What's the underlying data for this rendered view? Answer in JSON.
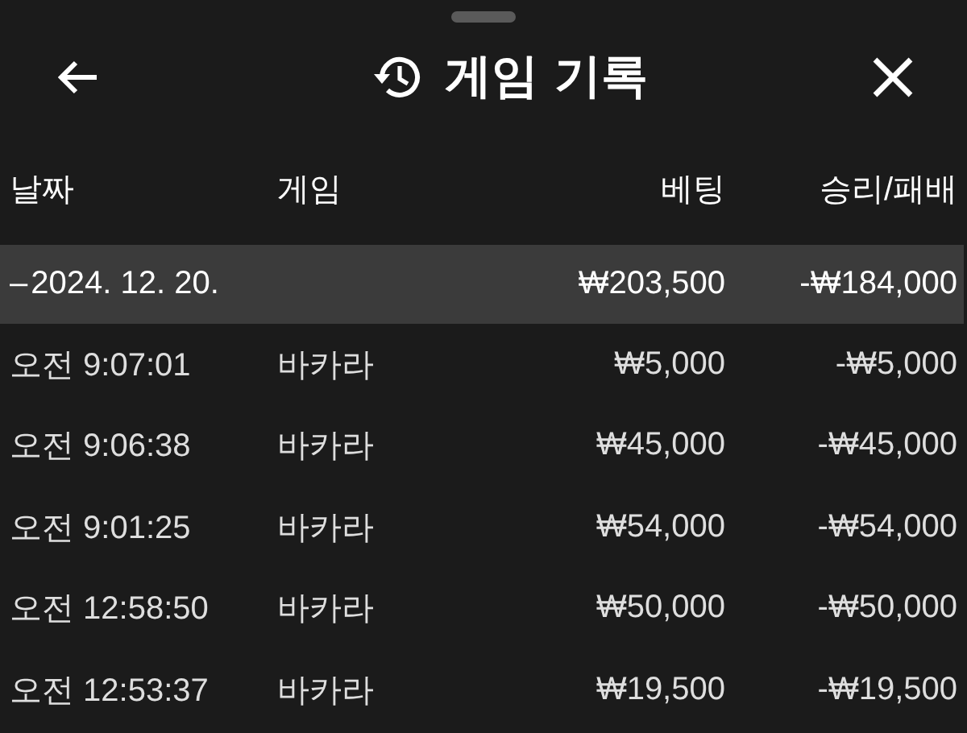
{
  "header": {
    "title": "게임 기록"
  },
  "table": {
    "columns": [
      "날짜",
      "게임",
      "베팅",
      "승리/패배"
    ],
    "groups": [
      {
        "toggle": "–",
        "date": "2024. 12. 20.",
        "bet": "₩203,500",
        "result": "-₩184,000",
        "expanded": true,
        "rows": [
          {
            "time": "오전 9:07:01",
            "game": "바카라",
            "bet": "₩5,000",
            "result": "-₩5,000"
          },
          {
            "time": "오전 9:06:38",
            "game": "바카라",
            "bet": "₩45,000",
            "result": "-₩45,000"
          },
          {
            "time": "오전 9:01:25",
            "game": "바카라",
            "bet": "₩54,000",
            "result": "-₩54,000"
          },
          {
            "time": "오전 12:58:50",
            "game": "바카라",
            "bet": "₩50,000",
            "result": "-₩50,000"
          },
          {
            "time": "오전 12:53:37",
            "game": "바카라",
            "bet": "₩19,500",
            "result": "-₩19,500"
          }
        ]
      }
    ]
  }
}
